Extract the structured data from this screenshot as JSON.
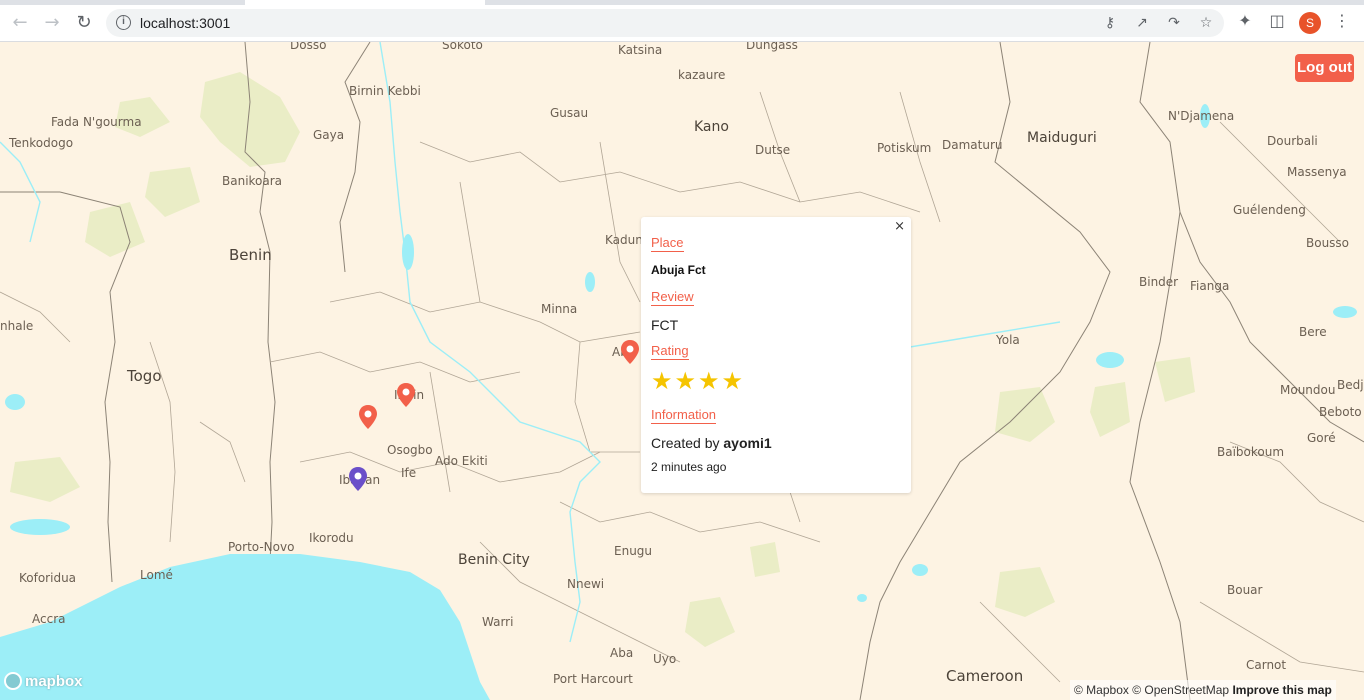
{
  "browser": {
    "url": "localhost:3001",
    "profile_initial": "S",
    "icons": {
      "back": "arrow-left-icon",
      "forward": "arrow-right-icon",
      "reload": "reload-icon",
      "site_info": "info-icon",
      "password": "key-icon",
      "open_in": "external-link-icon",
      "share": "share-icon",
      "bookmark": "star-outline-icon",
      "extensions": "puzzle-icon",
      "side_panel": "side-panel-icon",
      "menu": "kebab-menu-icon"
    }
  },
  "map": {
    "labels": {
      "dosso": "Dosso",
      "sokoto": "Sokoto",
      "katsina": "Katsina",
      "dungass": "Dungass",
      "kazaure": "kazaure",
      "birnin_kebbi": "Birnin Kebbi",
      "fada": "Fada N'gourma",
      "gusau": "Gusau",
      "kano": "Kano",
      "ndjamena": "N'Djamena",
      "tenkodogo": "Tenkodogo",
      "gaya": "Gaya",
      "dutse": "Dutse",
      "potiskum": "Potiskum",
      "damaturu": "Damaturu",
      "maiduguri": "Maiduguri",
      "dourbali": "Dourbali",
      "banikoara": "Banikoara",
      "massenya": "Massenya",
      "guelendeng": "Guélendeng",
      "benin": "Benin",
      "kaduna": "Kadun",
      "bousso": "Bousso",
      "binder": "Binder",
      "fianga": "Fianga",
      "nhale": "nhale",
      "minna": "Minna",
      "bere": "Bere",
      "yola": "Yola",
      "togo": "Togo",
      "abuja": "Ab",
      "ilorin": "Ilorin",
      "moundou": "Moundou",
      "bedje": "Bedj",
      "bebotо": "Beboto",
      "gore": "Goré",
      "osogbo": "Osogbo",
      "ado_ekiti": "Ado Ekiti",
      "baibokoum": "Baïbokoum",
      "ife": "Ife",
      "ibadan": "Ibadan",
      "porto_novo": "Porto-Novo",
      "ikorodu": "Ikorodu",
      "enugu": "Enugu",
      "koforidua": "Koforidua",
      "lome": "Lomé",
      "benin_city": "Benin City",
      "nnewi": "Nnewi",
      "bouar": "Bouar",
      "accra": "Accra",
      "warri": "Warri",
      "aba": "Aba",
      "uyo": "Uyo",
      "port_harcourt": "Port Harcourt",
      "cameroon": "Cameroon",
      "carnot": "Carnot"
    },
    "logout_label": "Log out",
    "mapbox_logo": "mapbox",
    "attribution": {
      "mapbox": "© Mapbox",
      "osm": "© OpenStreetMap",
      "improve": "Improve this map"
    },
    "colors": {
      "land": "#fdf3e3",
      "water": "#9ceef7",
      "park": "#eaedc6",
      "marker_other": "#f2604a",
      "marker_own": "#6a4fc9"
    }
  },
  "popup": {
    "close_symbol": "×",
    "place_label": "Place",
    "place_value": "Abuja Fct",
    "review_label": "Review",
    "review_value": "FCT",
    "rating_label": "Rating",
    "rating": 4,
    "rating_max": 4,
    "info_label": "Information",
    "created_by_prefix": "Created by",
    "created_by_user": "ayomi1",
    "time_ago": "2 minutes ago"
  }
}
